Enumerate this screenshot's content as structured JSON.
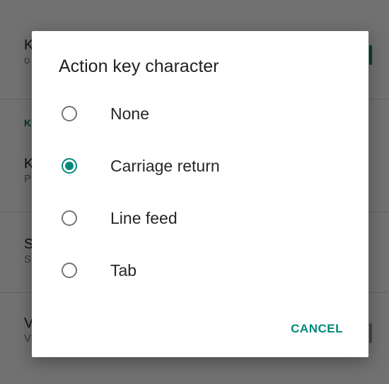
{
  "background": {
    "rows": [
      {
        "title": "K",
        "subtitle": "o"
      },
      {
        "title": "K",
        "subtitle": "P"
      },
      {
        "title": "S",
        "subtitle": "S"
      },
      {
        "title": "V",
        "subtitle": "V"
      }
    ],
    "section_label": "K"
  },
  "dialog": {
    "title": "Action key character",
    "options": [
      {
        "label": "None",
        "checked": false
      },
      {
        "label": "Carriage return",
        "checked": true
      },
      {
        "label": "Line feed",
        "checked": false
      },
      {
        "label": "Tab",
        "checked": false
      }
    ],
    "cancel_label": "CANCEL"
  },
  "colors": {
    "accent": "#00897b",
    "scrim": "rgba(0,0,0,0.55)"
  }
}
